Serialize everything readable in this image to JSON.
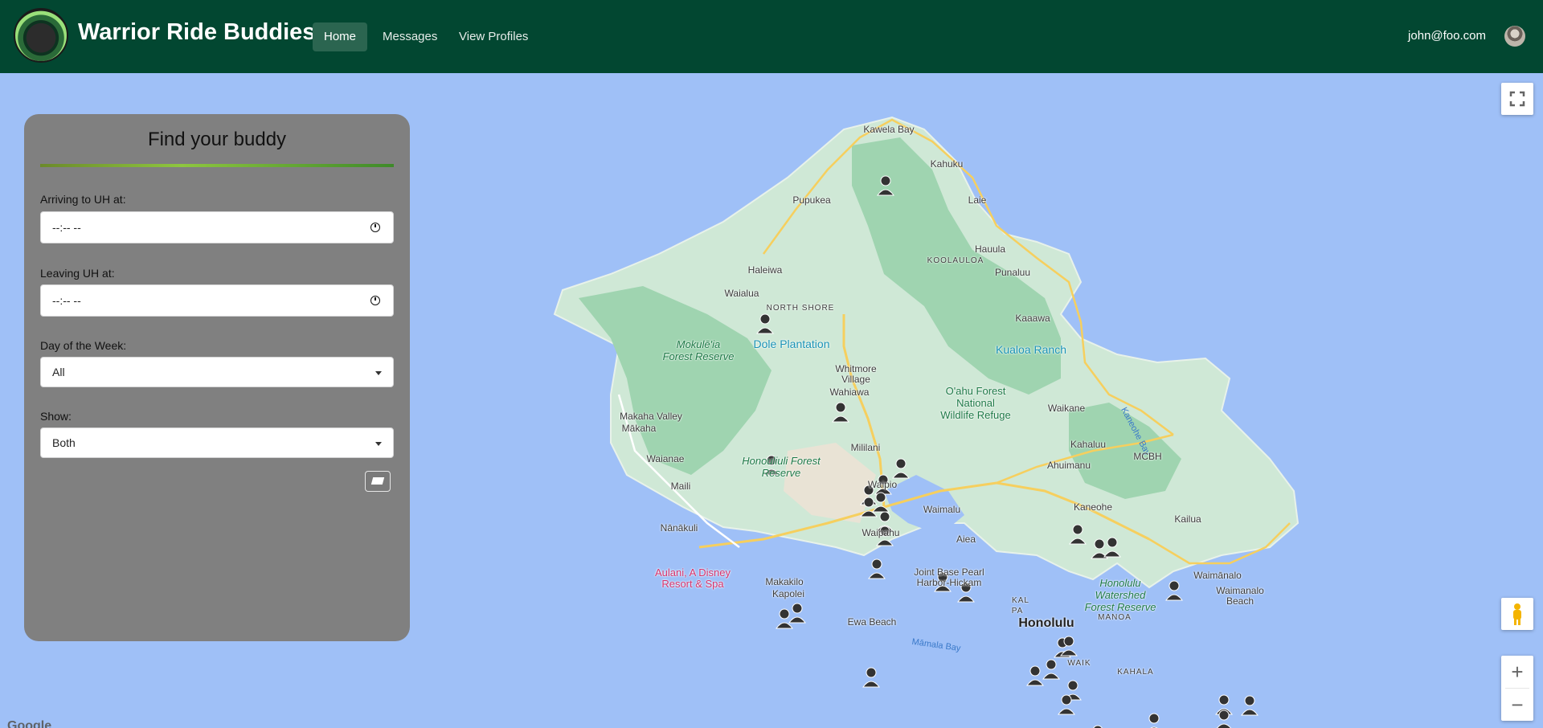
{
  "navbar": {
    "brand": "Warrior Ride Buddies",
    "links": [
      "Home",
      "Messages",
      "View Profiles"
    ],
    "active": "Home",
    "user_email": "john@foo.com"
  },
  "panel": {
    "title": "Find your buddy",
    "arriving_label": "Arriving to UH at:",
    "arriving_value": "--:-- --",
    "leaving_label": "Leaving UH at:",
    "leaving_value": "--:-- --",
    "day_label": "Day of the Week:",
    "day_value": "All",
    "show_label": "Show:",
    "show_value": "Both"
  },
  "map": {
    "labels": {
      "kawela_bay": "Kawela Bay",
      "kahuku": "Kahuku",
      "pupukea": "Pupukea",
      "laie": "Laie",
      "hauula": "Hauula",
      "koolauloa": "KOOLAULOA",
      "punaluu": "Punaluu",
      "haleiwa": "Haleiwa",
      "waialua": "Waialua",
      "north_shore": "NORTH SHORE",
      "kaaawa": "Kaaawa",
      "dole_plantation": "Dole Plantation",
      "kualoa_ranch": "Kualoa Ranch",
      "mokuleia_forest": "Mokulē'ia Forest Reserve",
      "whitmore": "Whitmore Village",
      "wahiawa": "Wahiawa",
      "oahu_forest": "O'ahu Forest National Wildlife Refuge",
      "waikane": "Waikane",
      "kaneohe_bay": "Kaneohe Bay",
      "makaha_valley": "Makaha Valley",
      "makaha": "Mākaha",
      "kahaluu": "Kahaluu",
      "ahuimanu": "Ahuimanu",
      "mcbh": "MCBH",
      "waianae": "Waianae",
      "honouliuli": "Honouliuli Forest Reserve",
      "mililani": "Mililani",
      "maili": "Maili",
      "waipio": "Waipio",
      "kaneohe": "Kaneohe",
      "kailua": "Kailua",
      "waimalu": "Waimalu",
      "aiea": "Aiea",
      "nanakuli": "Nānākuli",
      "waipahu": "Waipahu",
      "aulani": "Aulani, A Disney Resort & Spa",
      "makakilo": "Makakilo",
      "kapolei": "Kapolei",
      "jbphh": "Joint Base Pearl Harbor-Hickam",
      "honolulu_watershed": "Honolulu Watershed Forest Reserve",
      "waimanalo": "Waimānalo",
      "waimanalo_beach": "Waimanalo Beach",
      "manoa": "MANOA",
      "honolulu": "Honolulu",
      "ewa_beach": "Ewa Beach",
      "mamala_bay": "Māmala Bay",
      "waikiki": "WAIK",
      "kahala": "KAHALA",
      "kalihi": "KAL",
      "pala": "PA"
    },
    "google": "Google"
  },
  "colors": {
    "navbar": "#024731",
    "panel": "#808080",
    "water": "#9fc0f7",
    "land": "#cfe8d6",
    "forest": "#9fd4b0"
  }
}
